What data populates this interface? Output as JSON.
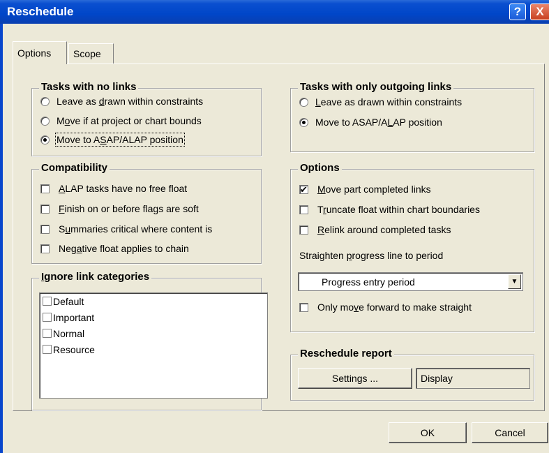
{
  "window": {
    "title": "Reschedule",
    "help_label": "?",
    "close_label": "X"
  },
  "tabs": [
    {
      "label": "Options",
      "active": true
    },
    {
      "label": "Scope",
      "active": false
    }
  ],
  "tasks_no_links": {
    "title": "Tasks with no links",
    "options": [
      {
        "pre": "Leave as ",
        "u": "d",
        "post": "rawn within constraints",
        "selected": false
      },
      {
        "pre": "M",
        "u": "o",
        "post": "ve if at project or chart bounds",
        "selected": false
      },
      {
        "pre": "Move to A",
        "u": "S",
        "post": "AP/ALAP position",
        "selected": true
      }
    ]
  },
  "tasks_outgoing": {
    "title": "Tasks with only outgoing links",
    "options": [
      {
        "pre": "",
        "u": "L",
        "post": "eave as drawn within constraints",
        "selected": false
      },
      {
        "pre": "Move to ASAP/A",
        "u": "L",
        "post": "AP position",
        "selected": true
      }
    ]
  },
  "compatibility": {
    "title": "Compatibility",
    "items": [
      {
        "pre": "",
        "u": "A",
        "post": "LAP tasks have no free float",
        "checked": false
      },
      {
        "pre": "",
        "u": "F",
        "post": "inish on or before flags are soft",
        "checked": false
      },
      {
        "pre": "S",
        "u": "u",
        "post": "mmaries critical where content is",
        "checked": false
      },
      {
        "pre": "Neg",
        "u": "a",
        "post": "tive float applies to chain",
        "checked": false
      }
    ]
  },
  "ignore_categories": {
    "title_pre": "",
    "title_u": "I",
    "title_post": "gnore link categories",
    "items": [
      "Default",
      "Important",
      "Normal",
      "Resource"
    ]
  },
  "options": {
    "title": "Options",
    "items": [
      {
        "pre": "",
        "u": "M",
        "post": "ove part completed links",
        "checked": true
      },
      {
        "pre": "T",
        "u": "r",
        "post": "uncate float within chart boundaries",
        "checked": false
      },
      {
        "pre": "",
        "u": "R",
        "post": "elink around completed tasks",
        "checked": false
      }
    ],
    "straighten_label_pre": "Straighten ",
    "straighten_label_u": "p",
    "straighten_label_post": "rogress line to period",
    "period_value": "Progress entry period",
    "only_forward": {
      "pre": "Only mo",
      "u": "v",
      "post": "e forward to make straight",
      "checked": false
    }
  },
  "report": {
    "title": "Reschedule report",
    "settings_label": "Settings ...",
    "display_value": "Display"
  },
  "footer": {
    "ok_label": "OK",
    "cancel_label": "Cancel"
  },
  "icons": {
    "check_mark": "✔",
    "dropdown": "▼"
  }
}
